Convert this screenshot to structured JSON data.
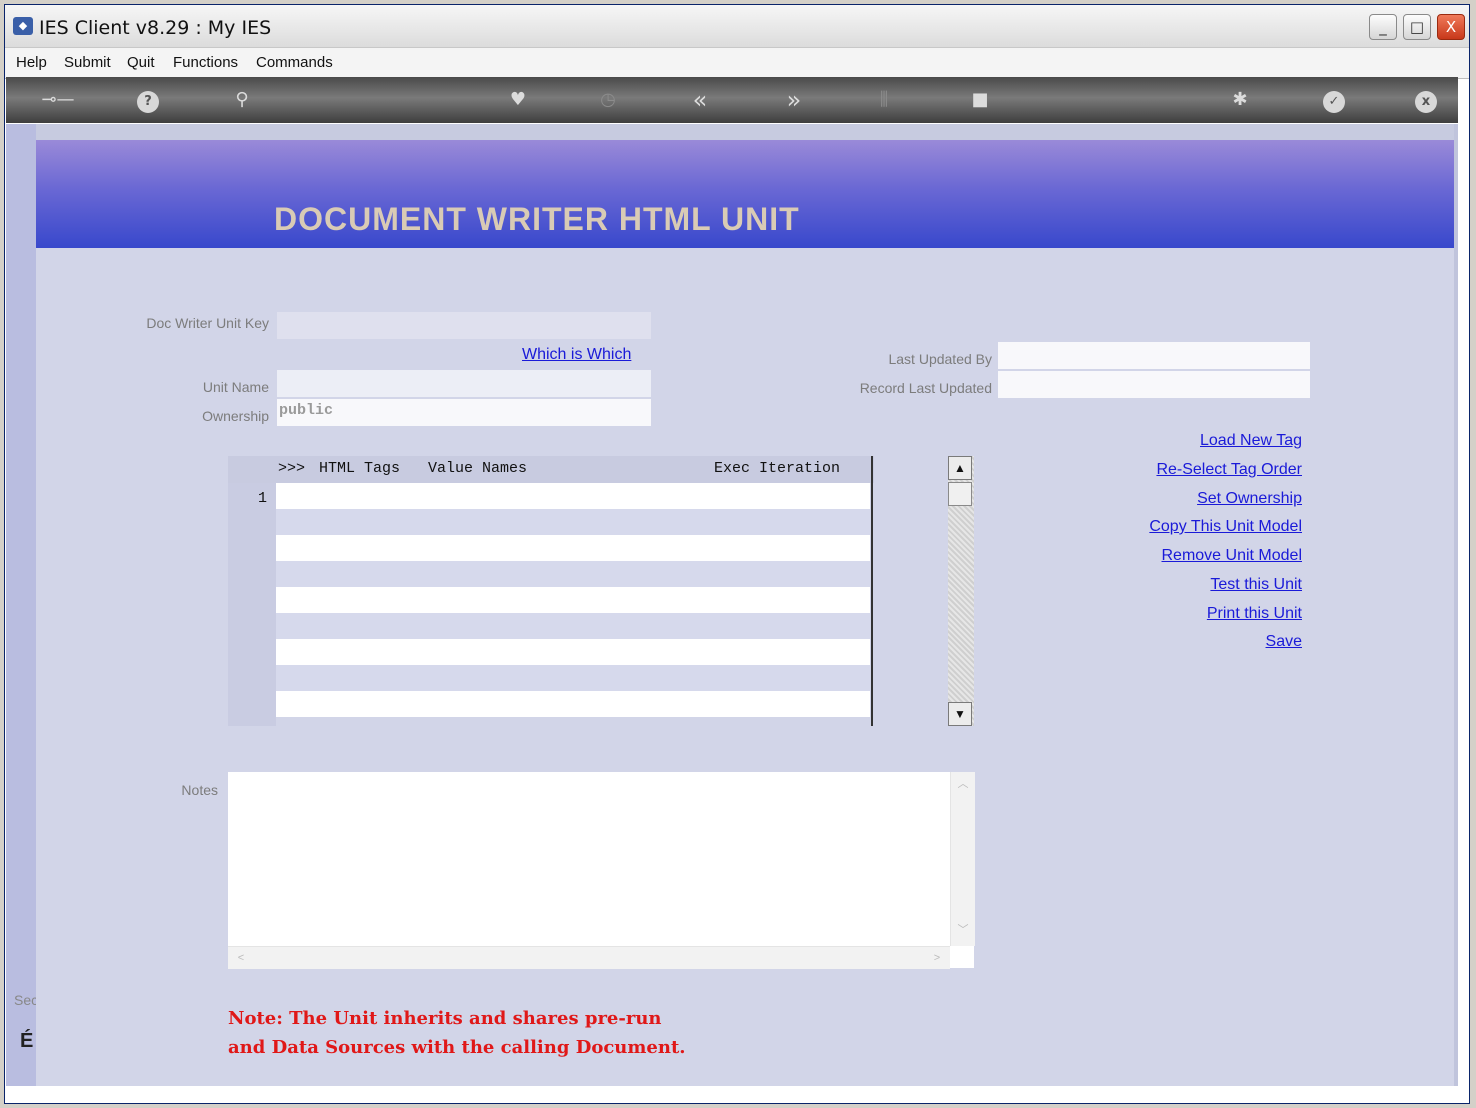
{
  "window": {
    "title": "IES Client v8.29 : My IES",
    "app_icon": "ies-app-icon",
    "controls": {
      "minimize": "_",
      "maximize": "□",
      "close": "X"
    }
  },
  "menubar": {
    "items": [
      "Help",
      "Submit",
      "Quit",
      "Functions",
      "Commands"
    ]
  },
  "toolbar": {
    "icons": [
      "key-icon",
      "help-icon",
      "search-icon",
      "heart-icon",
      "clock-icon",
      "rewind-icon",
      "forward-icon",
      "columns-icon",
      "stop-icon",
      "recycle-icon",
      "check-icon",
      "close-icon"
    ],
    "glyphs": {
      "help": "?",
      "check": "✓",
      "close": "x",
      "rewind": "«",
      "forward": "»",
      "clock": "◷",
      "heart": "♥",
      "search": "⚲",
      "key": "⊸—",
      "columns": "⫼",
      "stop": "■",
      "recycle": "✱"
    }
  },
  "banner": {
    "title": "DOCUMENT WRITER HTML UNIT"
  },
  "form": {
    "doc_writer_unit_key_label": "Doc Writer Unit Key",
    "doc_writer_unit_key_value": "",
    "which_is_which_link": "Which is Which",
    "unit_name_label": "Unit Name",
    "unit_name_value": "",
    "ownership_label": "Ownership",
    "ownership_value": "public",
    "last_updated_by_label": "Last Updated By",
    "last_updated_by_value": "",
    "record_last_updated_label": "Record Last Updated",
    "record_last_updated_value": ""
  },
  "grid": {
    "header_prefix": ">>>",
    "columns": [
      "HTML Tags",
      "Value Names",
      "Exec Iteration"
    ],
    "row_count_label": "1",
    "rows": 9
  },
  "actions": [
    "Load New Tag",
    "Re-Select Tag Order",
    "Set Ownership",
    "Copy This Unit Model",
    "Remove Unit Model",
    "Test this Unit",
    "Print this Unit",
    "Save"
  ],
  "notes": {
    "label": "Notes",
    "value": ""
  },
  "footer_note": {
    "line1": "Note: The Unit inherits and shares pre-run",
    "line2": "and Data Sources with the calling Document."
  },
  "sidebar": {
    "fragment_text": "Sec",
    "glyph": "É"
  }
}
